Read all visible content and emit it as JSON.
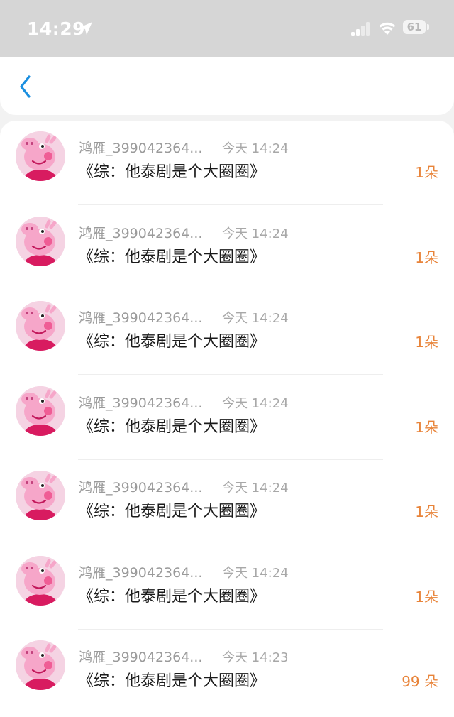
{
  "status_bar": {
    "time": "14:29",
    "battery": "61"
  },
  "items": [
    {
      "username": "鸿雁_399042364...",
      "time": "今天 14:24",
      "title": "《综：他泰剧是个大圈圈》",
      "amount": "1朵"
    },
    {
      "username": "鸿雁_399042364...",
      "time": "今天 14:24",
      "title": "《综：他泰剧是个大圈圈》",
      "amount": "1朵"
    },
    {
      "username": "鸿雁_399042364...",
      "time": "今天 14:24",
      "title": "《综：他泰剧是个大圈圈》",
      "amount": "1朵"
    },
    {
      "username": "鸿雁_399042364...",
      "time": "今天 14:24",
      "title": "《综：他泰剧是个大圈圈》",
      "amount": "1朵"
    },
    {
      "username": "鸿雁_399042364...",
      "time": "今天 14:24",
      "title": "《综：他泰剧是个大圈圈》",
      "amount": "1朵"
    },
    {
      "username": "鸿雁_399042364...",
      "time": "今天 14:24",
      "title": "《综：他泰剧是个大圈圈》",
      "amount": "1朵"
    },
    {
      "username": "鸿雁_399042364...",
      "time": "今天 14:23",
      "title": "《综：他泰剧是个大圈圈》",
      "amount": "99 朵"
    }
  ],
  "colors": {
    "accent": "#1a8fe0",
    "amount": "#e8843a"
  },
  "icons": {
    "back": "chevron-left-icon",
    "avatar": "peppa-pig-avatar"
  }
}
